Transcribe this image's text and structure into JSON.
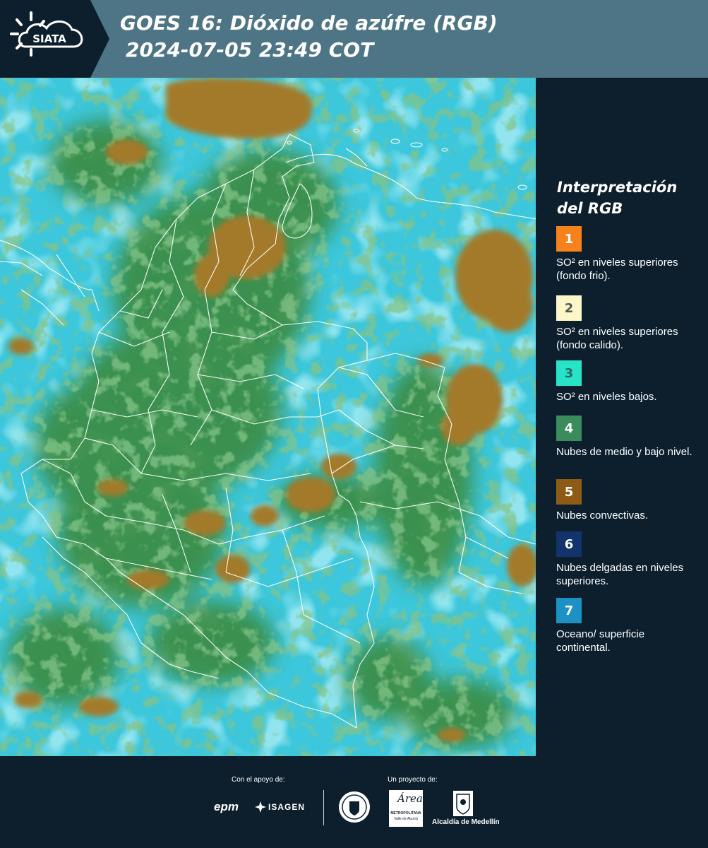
{
  "header": {
    "logo_text": "SIATA",
    "title_line1": "GOES 16: Dióxido de azúfre (RGB)",
    "title_line2": "2024-07-05 23:49 COT"
  },
  "map": {
    "icon": "satellite-rgb-map",
    "colors": {
      "background": "#3fc9dd",
      "green_clouds": "#3a8a40",
      "convective_clouds": "#a07828",
      "borders": "#ffffff"
    }
  },
  "legend": {
    "title": "Interpretación del RGB",
    "items": [
      {
        "number": "1",
        "color": "#f7811b",
        "text_color": "#ffffff",
        "label": "SO² en niveles superiores (fondo frio)."
      },
      {
        "number": "2",
        "color": "#fdf6c8",
        "text_color": "#555555",
        "label": "SO² en niveles superiores (fondo calido)."
      },
      {
        "number": "3",
        "color": "#27e3c8",
        "text_color": "#2a6b63",
        "label": "SO² en niveles bajos."
      },
      {
        "number": "4",
        "color": "#3a8c5c",
        "text_color": "#ffffff",
        "label": "Nubes de medio y bajo nivel."
      },
      {
        "number": "5",
        "color": "#8e5b14",
        "text_color": "#ffffff",
        "label": "Nubes convectivas."
      },
      {
        "number": "6",
        "color": "#13346b",
        "text_color": "#ffffff",
        "label": "Nubes delgadas en niveles superiores."
      },
      {
        "number": "7",
        "color": "#1b91c4",
        "text_color": "#ffffff",
        "label": "Oceano/ superficie continental."
      }
    ]
  },
  "footer": {
    "support_label": "Con el apoyo de:",
    "project_label": "Un proyecto de:",
    "brand_epm": "epm",
    "brand_isagen": "ISAGEN",
    "brand_area_name": "Área",
    "brand_area_line1": "METROPOLITANA",
    "brand_area_line2": "Valle de Aburrá",
    "brand_medellin": "Alcaldía de Medellín"
  }
}
